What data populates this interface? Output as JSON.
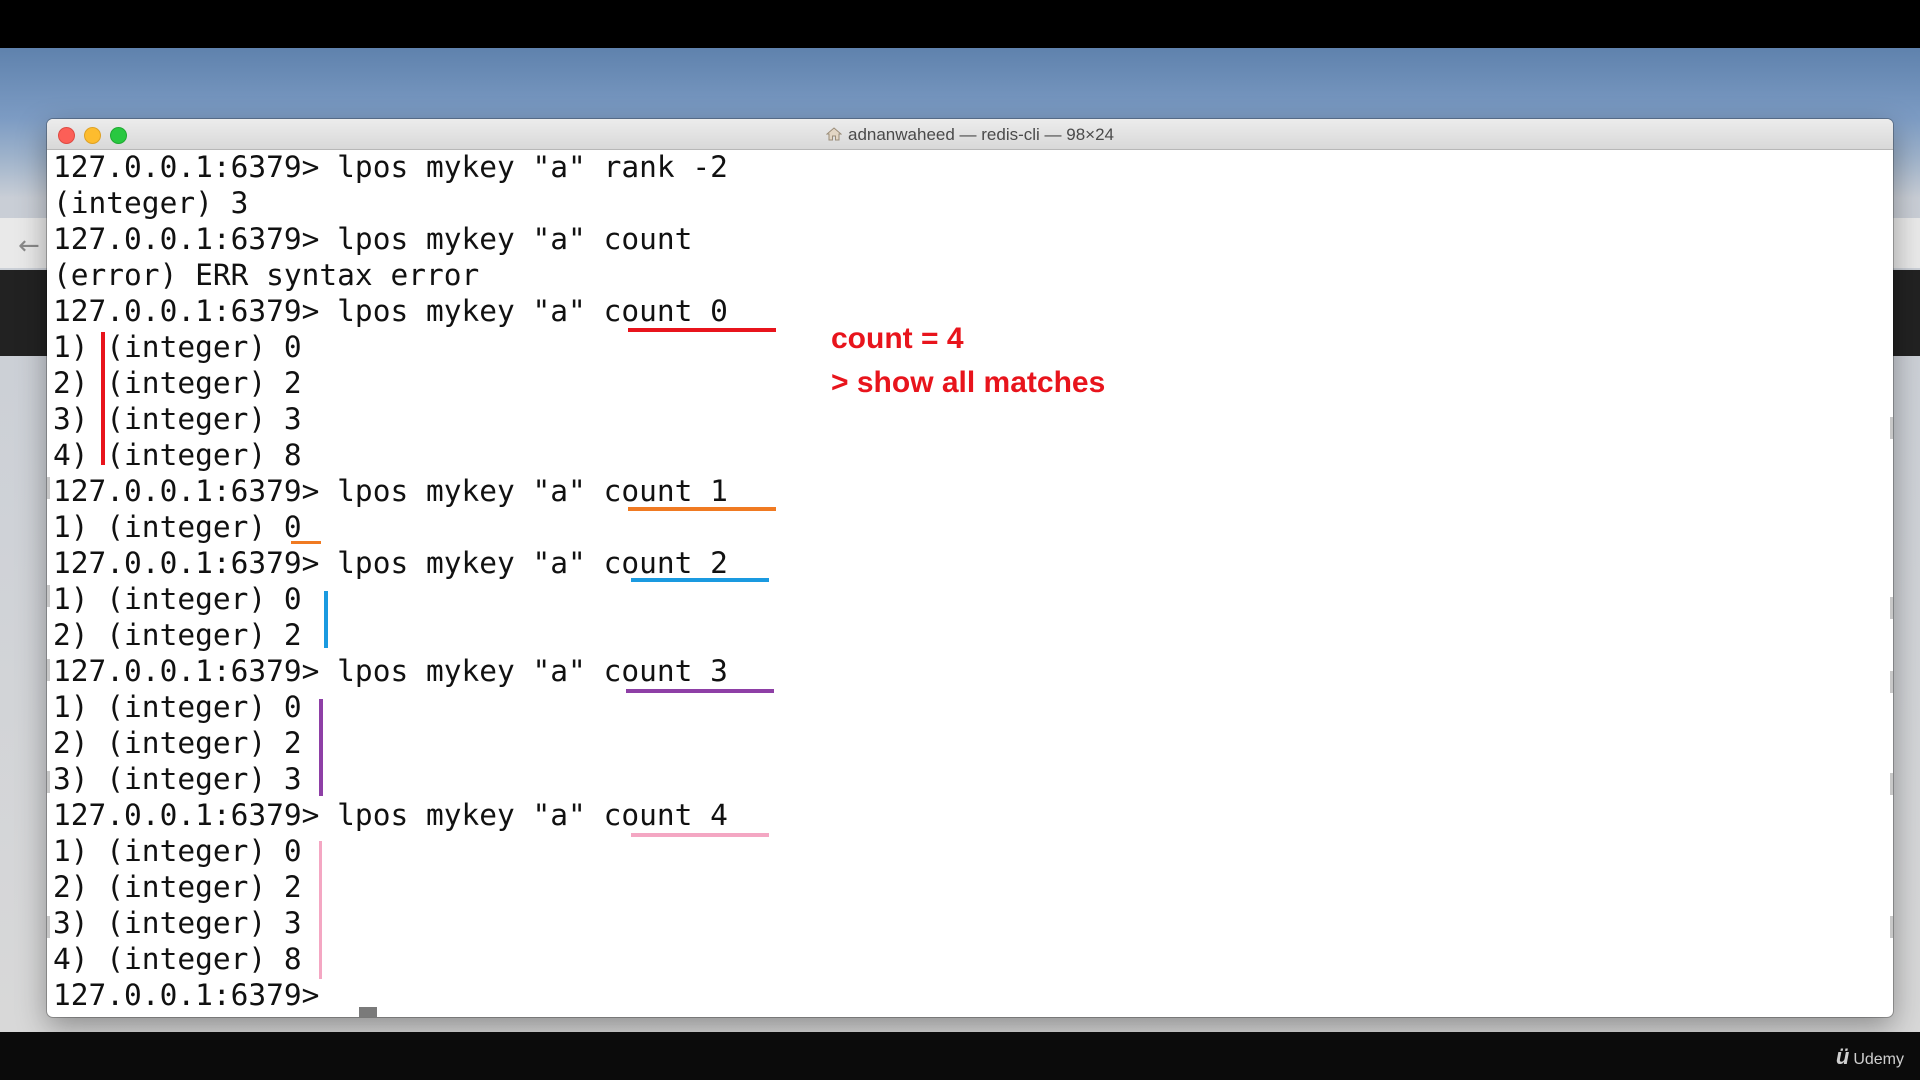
{
  "window": {
    "title": "adnanwaheed — redis-cli — 98×24"
  },
  "terminal": {
    "lines": [
      "127.0.0.1:6379> lpos mykey \"a\" rank -2",
      "(integer) 3",
      "127.0.0.1:6379> lpos mykey \"a\" count",
      "(error) ERR syntax error",
      "127.0.0.1:6379> lpos mykey \"a\" count 0",
      "1) (integer) 0",
      "2) (integer) 2",
      "3) (integer) 3",
      "4) (integer) 8",
      "127.0.0.1:6379> lpos mykey \"a\" count 1",
      "1) (integer) 0",
      "127.0.0.1:6379> lpos mykey \"a\" count 2",
      "1) (integer) 0",
      "2) (integer) 2",
      "127.0.0.1:6379> lpos mykey \"a\" count 3",
      "1) (integer) 0",
      "2) (integer) 2",
      "3) (integer) 3",
      "127.0.0.1:6379> lpos mykey \"a\" count 4",
      "1) (integer) 0",
      "2) (integer) 2",
      "3) (integer) 3",
      "4) (integer) 8",
      "127.0.0.1:6379> "
    ]
  },
  "annotation": {
    "line1": "count = 4",
    "line2": "> show all matches",
    "text_color": "#e8141c"
  },
  "highlight_colors": {
    "count0": "#e8141c",
    "count1": "#f07a22",
    "count2": "#1a9ae0",
    "count3": "#8e3fa6",
    "count4": "#f4a7c3"
  },
  "watermark": {
    "brand": "Udemy",
    "logo_icon": "udemy-logo-icon"
  }
}
